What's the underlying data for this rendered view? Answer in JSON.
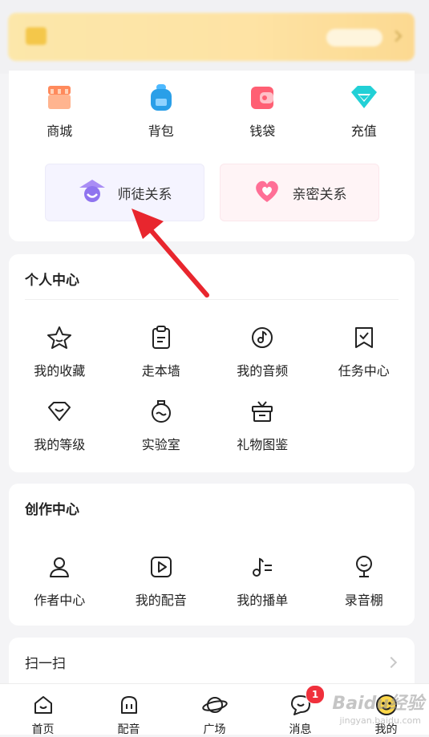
{
  "top_menu": [
    {
      "label": "商城",
      "icon": "shop-icon"
    },
    {
      "label": "背包",
      "icon": "backpack-icon"
    },
    {
      "label": "钱袋",
      "icon": "wallet-icon"
    },
    {
      "label": "充值",
      "icon": "diamond-icon"
    }
  ],
  "relations": [
    {
      "label": "师徒关系",
      "icon": "mentor-icon"
    },
    {
      "label": "亲密关系",
      "icon": "heart-icon"
    }
  ],
  "personal_center": {
    "title": "个人中心",
    "items": [
      {
        "label": "我的收藏",
        "icon": "star-icon"
      },
      {
        "label": "走本墙",
        "icon": "clipboard-icon"
      },
      {
        "label": "我的音频",
        "icon": "music-disc-icon"
      },
      {
        "label": "任务中心",
        "icon": "task-icon"
      },
      {
        "label": "我的等级",
        "icon": "level-gem-icon"
      },
      {
        "label": "实验室",
        "icon": "flask-icon"
      },
      {
        "label": "礼物图鉴",
        "icon": "gift-icon"
      }
    ]
  },
  "creation_center": {
    "title": "创作中心",
    "items": [
      {
        "label": "作者中心",
        "icon": "person-icon"
      },
      {
        "label": "我的配音",
        "icon": "play-icon"
      },
      {
        "label": "我的播单",
        "icon": "playlist-icon"
      },
      {
        "label": "录音棚",
        "icon": "microphone-icon"
      }
    ]
  },
  "scan": {
    "label": "扫一扫"
  },
  "tabbar": [
    {
      "label": "首页",
      "icon": "home-icon"
    },
    {
      "label": "配音",
      "icon": "dubbing-icon"
    },
    {
      "label": "广场",
      "icon": "planet-icon"
    },
    {
      "label": "消息",
      "icon": "message-icon",
      "badge": "1"
    },
    {
      "label": "我的",
      "icon": "profile-avatar-icon"
    }
  ],
  "watermark": {
    "text": "Baidu经验",
    "sub": "jingyan.baidu.com"
  }
}
